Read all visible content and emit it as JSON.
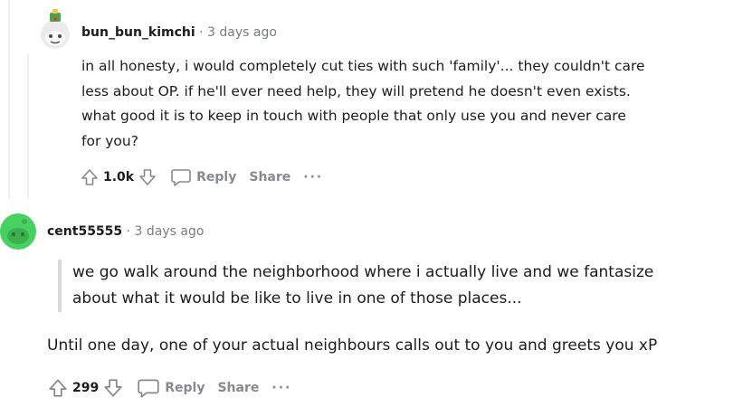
{
  "comments": [
    {
      "username": "bun_bun_kimchi",
      "separator": "·",
      "timestamp": "3 days ago",
      "body_lines": [
        "in all honesty, i would completely cut ties with such 'family'... they couldn't care",
        "less about OP. if he'll ever need help, they will pretend he doesn't even exists.",
        "what good it is to keep in touch with people that only use you and never care",
        "for you?"
      ],
      "votes": "1.0k",
      "reply_label": "Reply",
      "share_label": "Share",
      "more_label": "···",
      "avatar_icon": "snoo-avatar-icon"
    },
    {
      "username": "cent55555",
      "separator": "·",
      "timestamp": "3 days ago",
      "quote_lines": [
        "we go walk around the neighborhood where i actually live and we fantasize",
        "about what it would be like to live in one of those places..."
      ],
      "body_line": "Until one day, one of your actual neighbours calls out to you and greets you xP",
      "votes": "299",
      "reply_label": "Reply",
      "share_label": "Share",
      "more_label": "···",
      "avatar_icon": "green-snoo-avatar-icon"
    }
  ],
  "colors": {
    "text": "#1c1c1c",
    "muted": "#878a8c",
    "avatar_green": "#46d160",
    "thread_line": "#edeff1"
  }
}
